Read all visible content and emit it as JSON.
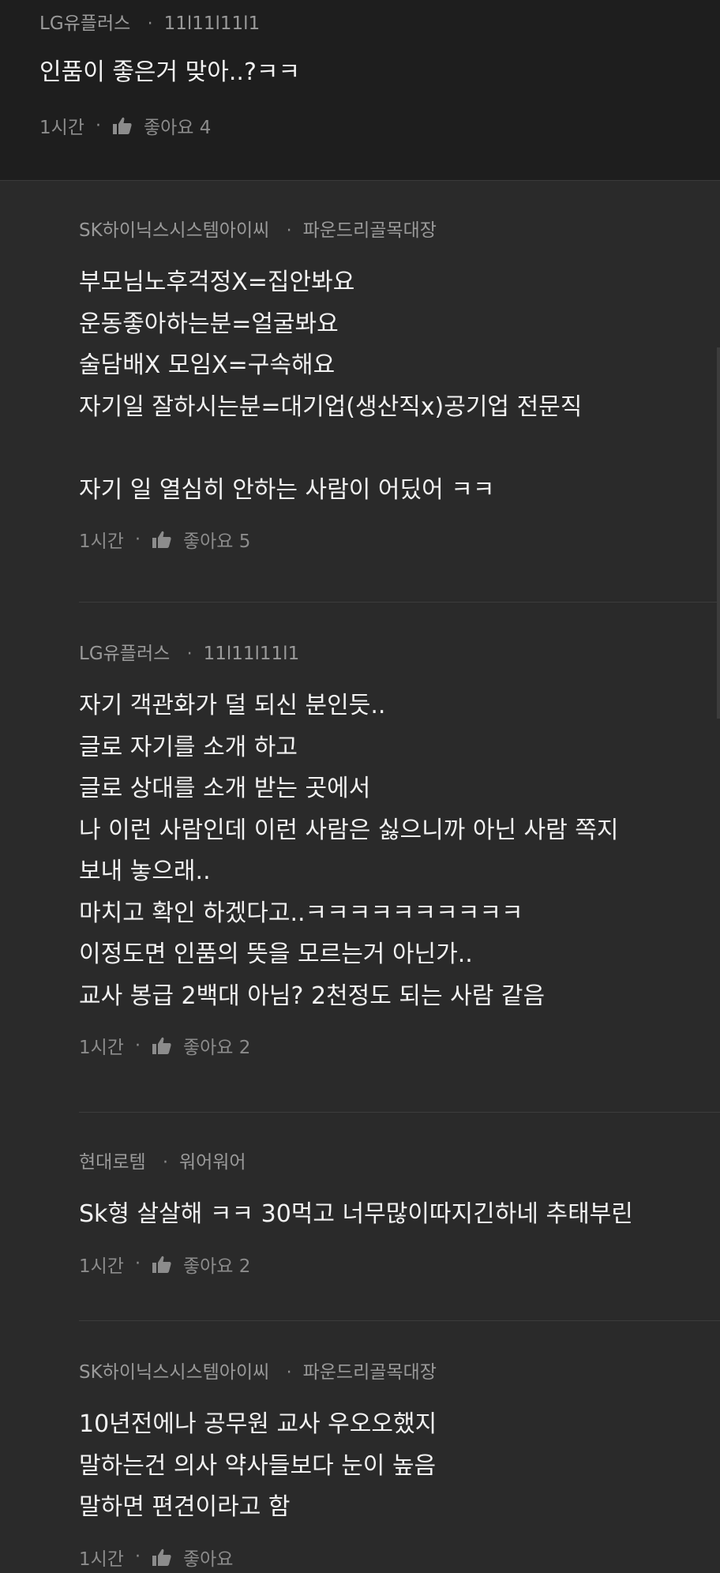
{
  "top_comment": {
    "author": "LG유플러스",
    "sep": "·",
    "nickname": "11l11l11l1",
    "text": "인품이 좋은거 맞아..?ㅋㅋ",
    "time": "1시간",
    "likes_label": "좋아요 4"
  },
  "replies": [
    {
      "author": "SK하이닉스시스템아이씨",
      "sep": "·",
      "nickname": "파운드리골목대장",
      "lines": [
        "부모님노후걱정X=집안봐요",
        "운동좋아하는분=얼굴봐요",
        "술담배X 모임X=구속해요",
        "자기일 잘하시는분=대기업(생산직x)공기업 전문직",
        "",
        "자기 일 열심히 안하는 사람이 어딨어 ㅋㅋ"
      ],
      "time": "1시간",
      "likes_label": "좋아요 5"
    },
    {
      "author": "LG유플러스",
      "sep": "·",
      "nickname": "11l11l11l1",
      "lines": [
        "자기 객관화가 덜 되신 분인듯..",
        "글로 자기를 소개 하고",
        "글로 상대를 소개 받는 곳에서",
        "나 이런 사람인데 이런 사람은 싫으니까 아닌 사람 쪽지",
        "보내 놓으래..",
        "마치고 확인 하겠다고..ㅋㅋㅋㅋㅋㅋㅋㅋㅋㅋ",
        "이정도면 인품의 뜻을 모르는거 아닌가..",
        "교사 봉급 2백대 아님? 2천정도 되는 사람 같음"
      ],
      "time": "1시간",
      "likes_label": "좋아요 2"
    },
    {
      "author": "현대로템",
      "sep": "·",
      "nickname": "워어워어",
      "lines": [
        "Sk형 살살해 ㅋㅋ 30먹고 너무많이따지긴하네 추태부린"
      ],
      "time": "1시간",
      "likes_label": "좋아요 2"
    },
    {
      "author": "SK하이닉스시스템아이씨",
      "sep": "·",
      "nickname": "파운드리골목대장",
      "lines": [
        "10년전에나 공무원 교사 우오오했지",
        "말하는건 의사 약사들보다 눈이 높음",
        "말하면 편견이라고 함"
      ],
      "time": "1시간",
      "likes_label": "좋아요"
    }
  ],
  "colors": {
    "background": "#2a2a2a",
    "top_background": "#1e1e1e",
    "text": "#f2f2f2",
    "meta": "#9a9a9a"
  },
  "icons": {
    "like": "thumbs-up-icon",
    "separator": "dot"
  }
}
